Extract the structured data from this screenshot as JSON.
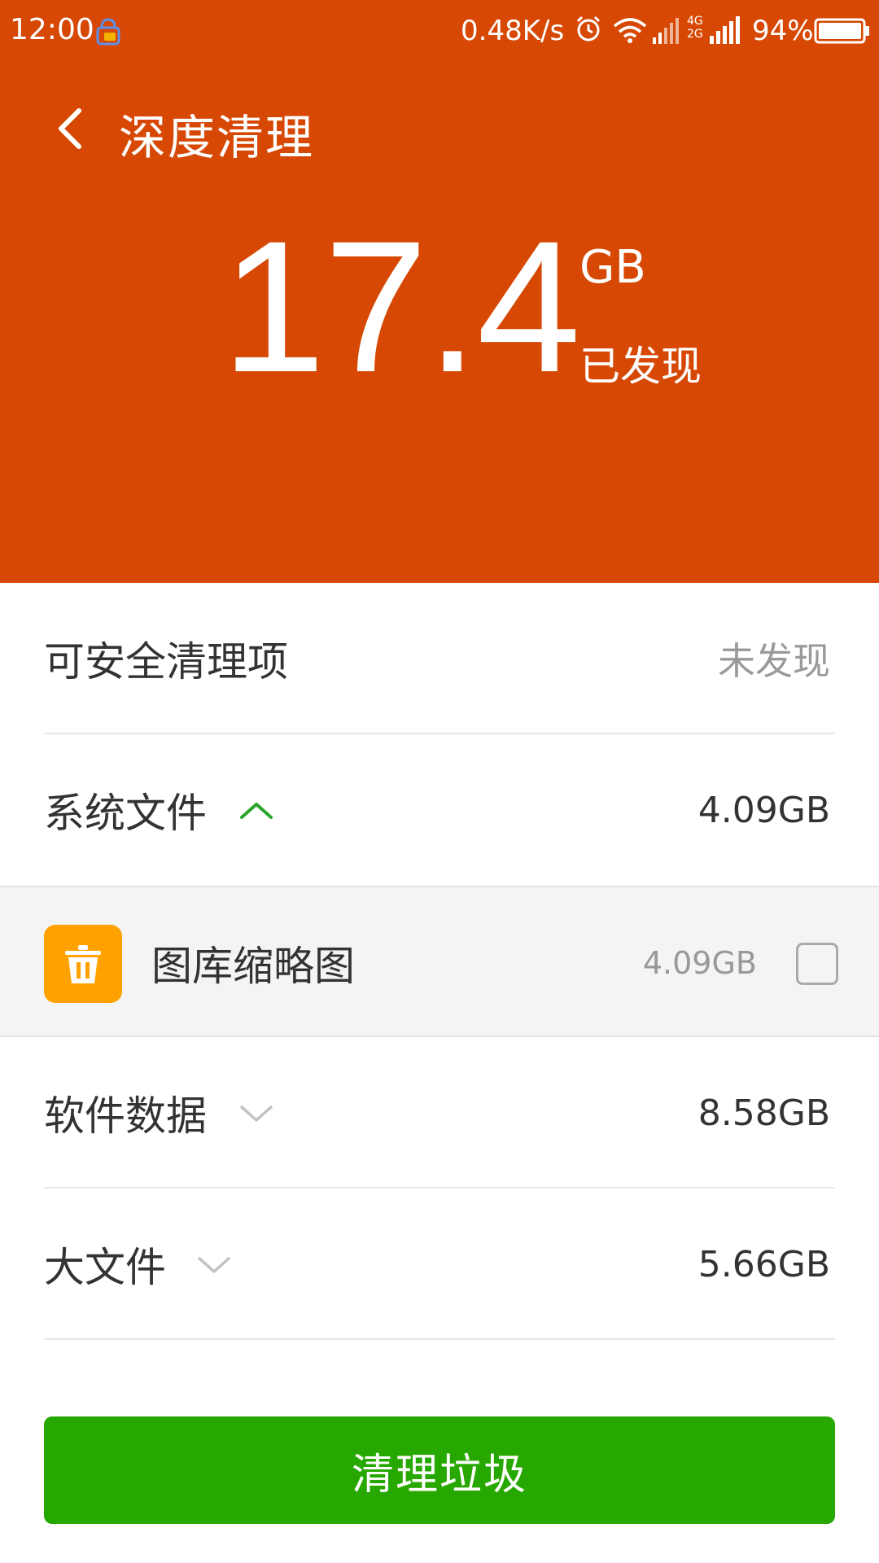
{
  "status_bar": {
    "time": "12:00",
    "net_speed": "0.48K/s",
    "net_tag_top": "4G",
    "net_tag_bottom": "2G",
    "battery_pct": "94%",
    "app_icon": "notification-app-icon",
    "alarm_icon": "alarm-icon",
    "wifi_icon": "wifi-icon",
    "signal_icon": "signal-icon",
    "battery_icon": "battery-icon"
  },
  "header": {
    "title": "深度清理",
    "back_icon": "back-arrow-icon",
    "total_size": "17.4",
    "total_unit": "GB",
    "found_label": "已发现",
    "bg_color": "#d64803"
  },
  "list": {
    "safe": {
      "label": "可安全清理项",
      "value": "未发现"
    },
    "system": {
      "label": "系统文件",
      "value": "4.09GB",
      "expanded": true
    },
    "system_children": [
      {
        "label": "图库缩略图",
        "value": "4.09GB",
        "checked": false,
        "icon": "trash-icon",
        "icon_color": "#ffa200"
      }
    ],
    "software": {
      "label": "软件数据",
      "value": "8.58GB",
      "expanded": false
    },
    "large": {
      "label": "大文件",
      "value": "5.66GB",
      "expanded": false
    }
  },
  "actions": {
    "clean_label": "清理垃圾",
    "clean_color": "#27a800"
  }
}
